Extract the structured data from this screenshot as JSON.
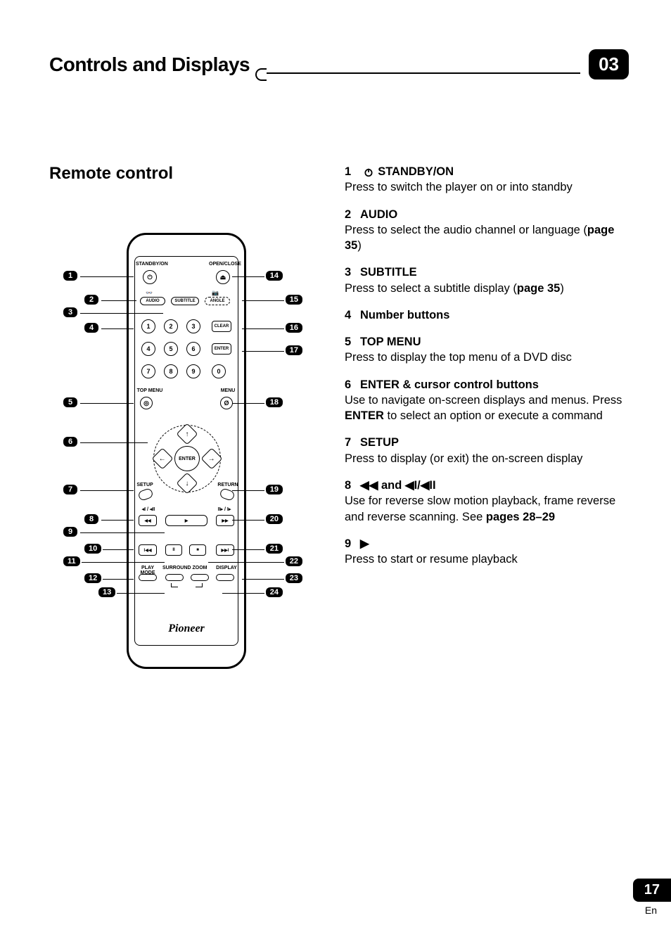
{
  "header": {
    "section_title": "Controls and Displays",
    "chapter": "03"
  },
  "subheading": "Remote control",
  "remote": {
    "labels": {
      "standby_on": "STANDBY/ON",
      "open_close": "OPEN/CLOSE",
      "audio": "AUDIO",
      "subtitle": "SUBTITLE",
      "angle": "ANGLE",
      "clear": "CLEAR",
      "enter": "ENTER",
      "top_menu": "TOP MENU",
      "menu": "MENU",
      "setup": "SETUP",
      "return": "RETURN",
      "play_mode": "PLAY MODE",
      "surround": "SURROUND",
      "zoom": "ZOOM",
      "display": "DISPLAY",
      "enter_center": "ENTER"
    },
    "numbers": [
      "1",
      "2",
      "3",
      "4",
      "5",
      "6",
      "7",
      "8",
      "9",
      "0"
    ],
    "brand": "Pioneer",
    "rev_slow_label": "◂I / ◂II",
    "fwd_slow_label": "II▸ / I▸"
  },
  "callouts_left": [
    "1",
    "2",
    "3",
    "4",
    "5",
    "6",
    "7",
    "8",
    "9",
    "10",
    "11",
    "12",
    "13"
  ],
  "callouts_right": [
    "14",
    "15",
    "16",
    "17",
    "18",
    "19",
    "20",
    "21",
    "22",
    "23",
    "24"
  ],
  "descriptions": [
    {
      "num": "1",
      "icon": "power",
      "title": "STANDBY/ON",
      "body": "Press to switch the player on or into standby"
    },
    {
      "num": "2",
      "title": "AUDIO",
      "body_pre": "Press to select the audio channel or language (",
      "bold": "page 35",
      "body_post": ")"
    },
    {
      "num": "3",
      "title": "SUBTITLE",
      "body_pre": "Press to select a subtitle display (",
      "bold": "page 35",
      "body_post": ")"
    },
    {
      "num": "4",
      "title": "Number buttons",
      "body": ""
    },
    {
      "num": "5",
      "title": "TOP MENU",
      "body": "Press to display the top menu of a DVD disc"
    },
    {
      "num": "6",
      "title": "ENTER & cursor control buttons",
      "body_pre": "Use to navigate on-screen displays and menus. Press ",
      "bold": "ENTER",
      "body_post": " to select an option or execute a command"
    },
    {
      "num": "7",
      "title": "SETUP",
      "body": "Press to display (or exit) the on-screen display"
    },
    {
      "num": "8",
      "title_glyph": "◀◀ and ◀I/◀II",
      "body_pre": "Use for reverse slow motion playback, frame reverse and reverse scanning. See ",
      "bold": "pages 28–29",
      "body_post": ""
    },
    {
      "num": "9",
      "title_glyph": "▶",
      "body": "Press to start or resume playback"
    }
  ],
  "footer": {
    "page_number": "17",
    "lang": "En"
  }
}
